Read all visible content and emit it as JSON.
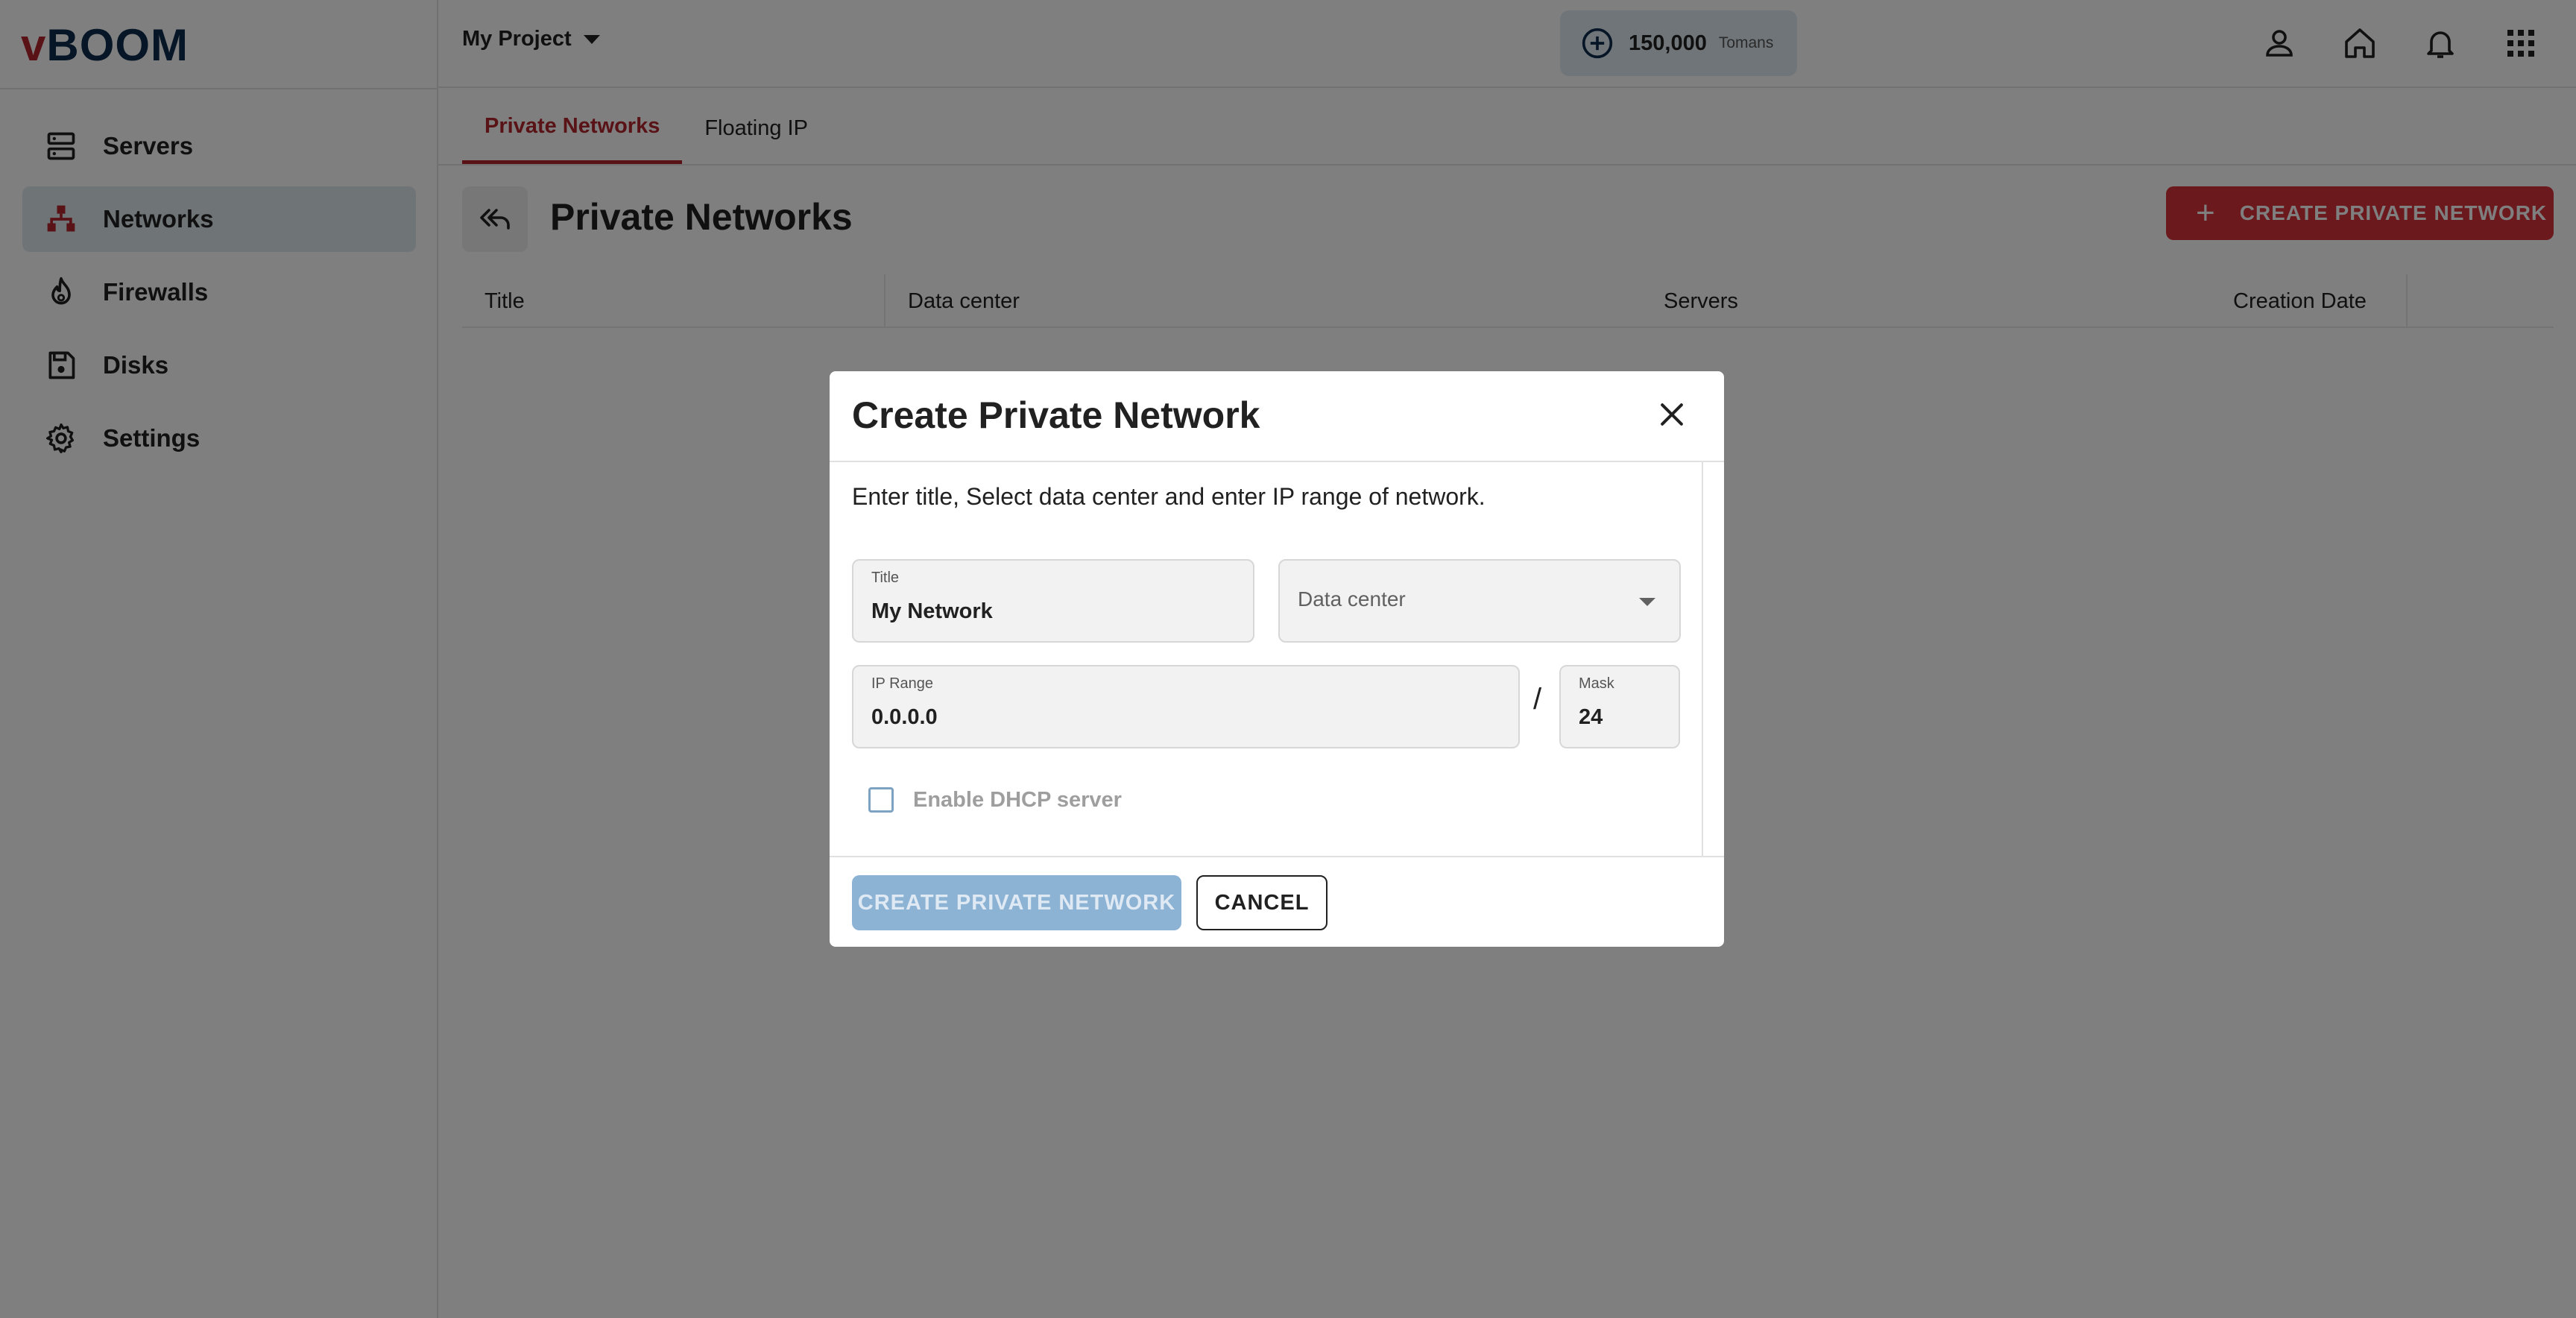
{
  "app": {
    "logo_v": "v",
    "logo_rest": "BOOM"
  },
  "sidebar": {
    "items": [
      {
        "label": "Servers",
        "icon": "servers-icon"
      },
      {
        "label": "Networks",
        "icon": "networks-icon",
        "active": true
      },
      {
        "label": "Firewalls",
        "icon": "firewall-icon"
      },
      {
        "label": "Disks",
        "icon": "disk-icon"
      },
      {
        "label": "Settings",
        "icon": "gear-icon"
      }
    ]
  },
  "header": {
    "project": "My Project",
    "credit_amount": "150,000",
    "credit_unit": "Tomans",
    "icons": [
      "add-credit-icon",
      "user-icon",
      "home-icon",
      "bell-icon",
      "apps-grid-icon"
    ]
  },
  "tabs": [
    {
      "label": "Private Networks",
      "active": true
    },
    {
      "label": "Floating IP"
    }
  ],
  "page": {
    "title": "Private Networks",
    "create_button": "CREATE PRIVATE NETWORK",
    "table_headers": [
      "Title",
      "Data center",
      "Servers",
      "Creation Date"
    ]
  },
  "dialog": {
    "title": "Create Private Network",
    "description": "Enter title, Select data center and enter IP range of network.",
    "title_field": {
      "label": "Title",
      "value": "My Network"
    },
    "datacenter_field": {
      "placeholder": "Data center"
    },
    "ip_field": {
      "label": "IP Range",
      "value": "0.0.0.0"
    },
    "slash": "/",
    "mask_field": {
      "label": "Mask",
      "value": "24"
    },
    "dhcp_label": "Enable DHCP server",
    "submit_label": "CREATE PRIVATE NETWORK",
    "cancel_label": "CANCEL"
  },
  "colors": {
    "brand_red": "#b3242c",
    "brand_navy": "#0d2d4e",
    "accent_blue": "#8cb2d4"
  }
}
